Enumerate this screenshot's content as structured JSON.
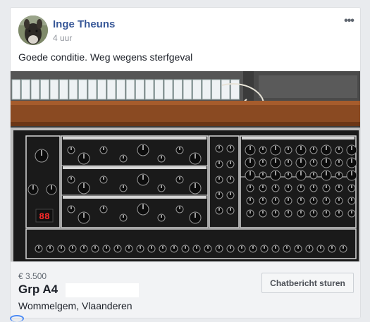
{
  "post": {
    "author": "Inge Theuns",
    "time": "4 uur",
    "text": "Goede conditie. Weg wegens sterfgeval",
    "photo_alt": "Grp A4 synthesizer"
  },
  "listing": {
    "price": "€ 3.500",
    "title": "Grp A4",
    "location": "Wommelgem, Vlaanderen",
    "chat_button": "Chatbericht sturen"
  },
  "icons": {
    "more": "more-options-icon",
    "avatar": "avatar"
  },
  "colors": {
    "author": "#385898",
    "page_bg": "#e9ebee",
    "led_display": "#ff2a2a"
  }
}
